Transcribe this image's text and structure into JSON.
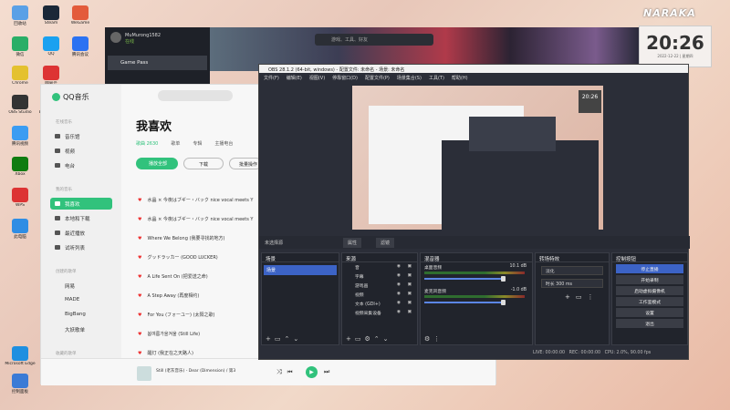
{
  "desktop": {
    "icons": [
      {
        "label": "回收站",
        "color": "#5aa0e6"
      },
      {
        "label": "Steam",
        "color": "#1b2838"
      },
      {
        "label": "WeGame",
        "color": "#e35b3b"
      },
      {
        "label": "微信",
        "color": "#2aae67"
      },
      {
        "label": "QQ",
        "color": "#1aa1f0"
      },
      {
        "label": "腾讯会议",
        "color": "#2b72f2"
      },
      {
        "label": "Chrome",
        "color": "#e4c12f"
      },
      {
        "label": "网易云",
        "color": "#d33"
      },
      {
        "label": "OBS Studio",
        "color": "#333"
      },
      {
        "label": "Epic Games",
        "color": "#222"
      },
      {
        "label": "腾讯视频",
        "color": "#3b9cf2"
      },
      {
        "label": "Uplay",
        "color": "#2f6fd8"
      },
      {
        "label": "Xbox",
        "color": "#107c10"
      },
      {
        "label": "Origin",
        "color": "#f56c2d"
      },
      {
        "label": "WPS",
        "color": "#d33"
      },
      {
        "label": "此电脑",
        "color": "#2f8de4"
      },
      {
        "label": "Microsoft Edge",
        "color": "#1f8fe0"
      },
      {
        "label": "控制面板",
        "color": "#3b7bd6"
      }
    ]
  },
  "steam": {
    "username": "MuMurong1582",
    "friends_status": "在线",
    "selected_game": "Game Pass",
    "search_placeholder": "游戏、工具、好友"
  },
  "game_banner": "NARAKA",
  "clock": {
    "time": "20:26",
    "date": "2022-12-22 | 星期四"
  },
  "qq": {
    "app_name": "QQ音乐",
    "search_placeholder": "搜索音乐",
    "sections": {
      "online": "在线音乐",
      "mine": "我的音乐",
      "created": "创建的歌单",
      "collected": "收藏的歌单"
    },
    "nav": [
      {
        "label": "音乐馆"
      },
      {
        "label": "视频"
      },
      {
        "label": "电台"
      },
      {
        "label": "我喜欢"
      },
      {
        "label": "本地和下载"
      },
      {
        "label": "最近播放"
      },
      {
        "label": "试听列表"
      }
    ],
    "playlists": [
      "网易",
      "MADE",
      "BigBang",
      "大妖歌单"
    ],
    "page_title": "我喜欢",
    "tabs": [
      "歌曲 2630",
      "歌单",
      "专辑",
      "主播电台",
      "视频"
    ],
    "buttons": {
      "play_all": "播放全部",
      "download": "下载",
      "batch": "批量操作"
    },
    "songs": [
      "水晶 × 今夜はブギー・バック nice vocal meets Y",
      "水晶 × 今夜はブギー・バック nice vocal meets Y",
      "Where We Belong (我要寻找的地方)",
      "グッドラッカー (GOOD LUCKER)",
      "A Life Sent On (把爱送之命)",
      "A Step Away (再度相约)",
      "For You (フォーユー) (太阳之歌)",
      "봄여름가을겨울 (Still Life)",
      "醒灯 (我正在之天路人)"
    ],
    "player": {
      "now_playing": "Still (老灰音乐) - Dear (Dimension) / 第3"
    }
  },
  "obs": {
    "window_title": "OBS 28.1.2 (64-bit, windows) - 配置文件: 未命名 - 场景: 未命名",
    "menu": [
      "文件(F)",
      "编辑(E)",
      "视图(V)",
      "停靠窗口(D)",
      "配置文件(P)",
      "场景集合(S)",
      "工具(T)",
      "帮助(H)"
    ],
    "source_toolbar": {
      "no_source": "未选择源",
      "properties": "属性",
      "filters": "滤镜"
    },
    "docks": {
      "scenes": {
        "title": "场景",
        "items": [
          "场景"
        ]
      },
      "sources": {
        "title": "来源",
        "items": [
          "音",
          "字幕",
          "游戏画",
          "视频",
          "文本 (GDI+)",
          "视频采集设备"
        ]
      },
      "mixer": {
        "title": "混音器",
        "channels": [
          {
            "name": "桌面音频",
            "db": "10.1 dB"
          },
          {
            "name": "麦克风音频",
            "db": "-1.0 dB"
          }
        ]
      },
      "transitions": {
        "title": "转场特效",
        "type": "淡化",
        "duration_label": "时长",
        "duration": "300 ms"
      },
      "controls": {
        "title": "控制按钮",
        "buttons": [
          "停止直播",
          "开始录制",
          "启动虚拟摄像机",
          "工作室模式",
          "设置",
          "退出"
        ]
      }
    },
    "status": {
      "live": "LIVE: 00:00:00",
      "rec": "REC: 00:00:00",
      "cpu": "CPU: 2.0%, 90.00 fps"
    }
  }
}
